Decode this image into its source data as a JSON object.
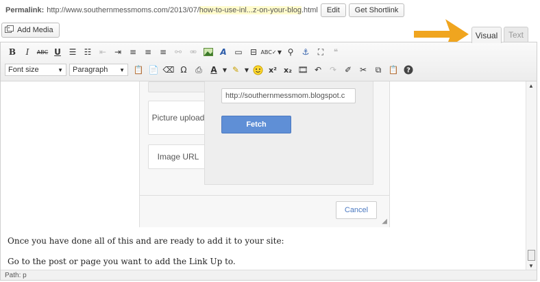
{
  "permalink": {
    "label": "Permalink:",
    "url_prefix": "http://www.southernmessmoms.com/2013/07/",
    "slug": "how-to-use-inl...z-on-your-blog",
    "url_suffix": ".html",
    "edit_label": "Edit",
    "shortlink_label": "Get Shortlink"
  },
  "add_media_label": "Add Media",
  "tabs": {
    "visual": "Visual",
    "text": "Text"
  },
  "toolbar": {
    "font_size": "Font size",
    "format": "Paragraph"
  },
  "dialog": {
    "side_items": [
      "Picture upload",
      "Image URL"
    ],
    "url_value": "http://southernmessmom.blogspot.c",
    "fetch_label": "Fetch",
    "cancel_label": "Cancel"
  },
  "content": {
    "paragraph_1": "Once you have done all of this and are ready to add it to your site:",
    "paragraph_2": "Go to the post or page you want to add the Link Up to."
  },
  "status": {
    "path": "Path: p"
  },
  "colors": {
    "arrow": "#f0a51f",
    "fetch": "#5f8fd6"
  }
}
